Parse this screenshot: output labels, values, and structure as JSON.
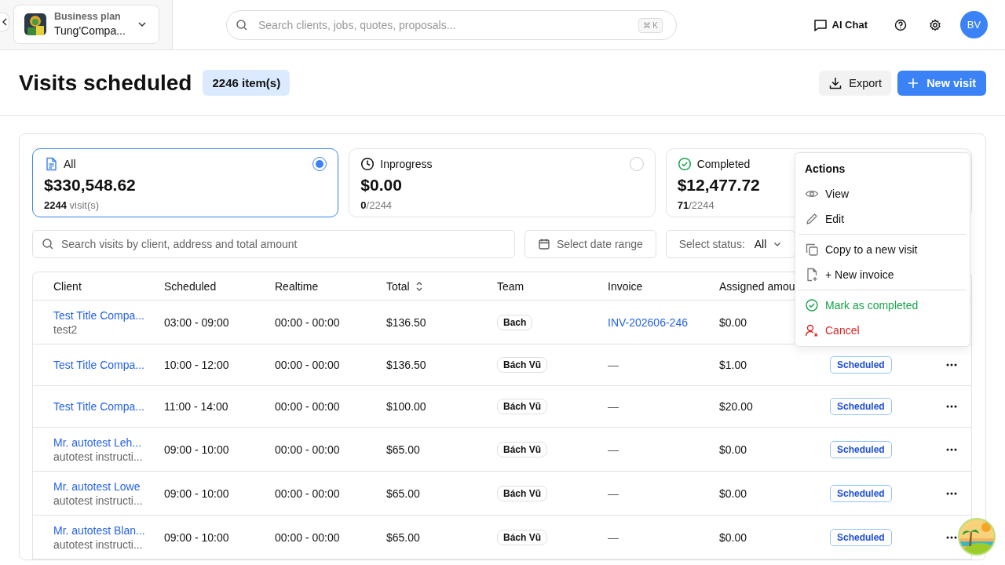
{
  "company": {
    "plan": "Business plan",
    "name": "Tung'Compa..."
  },
  "search": {
    "placeholder": "Search clients, jobs, quotes, proposals...",
    "shortcut": "⌘ K"
  },
  "topbar": {
    "ai_chat": "AI Chat",
    "avatar": "BV"
  },
  "page": {
    "title": "Visits scheduled",
    "count": "2246 item(s)",
    "export": "Export",
    "new_visit": "New visit"
  },
  "stats": [
    {
      "kind": "all",
      "label": "All",
      "amount": "$330,548.62",
      "count": "2244",
      "suffix": "visit(s)",
      "selected": true
    },
    {
      "kind": "inprogress",
      "label": "Inprogress",
      "amount": "$0.00",
      "count": "0",
      "suffix": "/2244",
      "selected": false
    },
    {
      "kind": "completed",
      "label": "Completed",
      "amount": "$12,477.72",
      "count": "71",
      "suffix": "/2244"
    }
  ],
  "filters": {
    "search_placeholder": "Search visits by client, address and total amount",
    "date_placeholder": "Select date range",
    "status_label": "Select status:",
    "status_value": "All"
  },
  "table": {
    "columns": [
      {
        "label": "Client",
        "sortable": false
      },
      {
        "label": "Scheduled",
        "sortable": false
      },
      {
        "label": "Realtime",
        "sortable": false
      },
      {
        "label": "Total",
        "sortable": true
      },
      {
        "label": "Team",
        "sortable": false
      },
      {
        "label": "Invoice",
        "sortable": false
      },
      {
        "label": "Assigned amou"
      }
    ],
    "rows": [
      {
        "client": "Test Title Compa...",
        "sub": "test2",
        "scheduled": "03:00 - 09:00",
        "realtime": "00:00 - 00:00",
        "total": "$136.50",
        "team": "Bach",
        "invoice": "INV-202606-246",
        "invoice_link": true,
        "assigned": "$0.00"
      },
      {
        "client": "Test Title Compa...",
        "scheduled": "10:00 - 12:00",
        "realtime": "00:00 - 00:00",
        "total": "$136.50",
        "team": "Bách Vũ",
        "invoice": "—",
        "invoice_link": false,
        "assigned": "$1.00",
        "status": "Scheduled"
      },
      {
        "client": "Test Title Compa...",
        "scheduled": "11:00 - 14:00",
        "realtime": "00:00 - 00:00",
        "total": "$100.00",
        "team": "Bách Vũ",
        "invoice": "—",
        "invoice_link": false,
        "assigned": "$20.00",
        "status": "Scheduled"
      },
      {
        "client": "Mr. autotest Leh...",
        "sub": "autotest instructi...",
        "scheduled": "09:00 - 10:00",
        "realtime": "00:00 - 00:00",
        "total": "$65.00",
        "team": "Bách Vũ",
        "invoice": "—",
        "invoice_link": false,
        "assigned": "$0.00",
        "status": "Scheduled"
      },
      {
        "client": "Mr. autotest Lowe",
        "sub": "autotest instructi...",
        "scheduled": "09:00 - 10:00",
        "realtime": "00:00 - 00:00",
        "total": "$65.00",
        "team": "Bách Vũ",
        "invoice": "—",
        "invoice_link": false,
        "assigned": "$0.00",
        "status": "Scheduled"
      },
      {
        "client": "Mr. autotest Blan...",
        "sub": "autotest instructi...",
        "scheduled": "09:00 - 10:00",
        "realtime": "00:00 - 00:00",
        "total": "$65.00",
        "team": "Bách Vũ",
        "invoice": "—",
        "invoice_link": false,
        "assigned": "$0.00",
        "status": "Scheduled"
      }
    ]
  },
  "menu": {
    "title": "Actions",
    "groups": [
      [
        {
          "kind": "view",
          "label": "View"
        },
        {
          "kind": "edit",
          "label": "Edit"
        }
      ],
      [
        {
          "kind": "copy",
          "label": "Copy to a new visit"
        },
        {
          "kind": "invoice",
          "label": "+ New invoice"
        }
      ],
      [
        {
          "kind": "complete",
          "label": "Mark as completed"
        },
        {
          "kind": "cancel",
          "label": "Cancel"
        }
      ]
    ]
  }
}
